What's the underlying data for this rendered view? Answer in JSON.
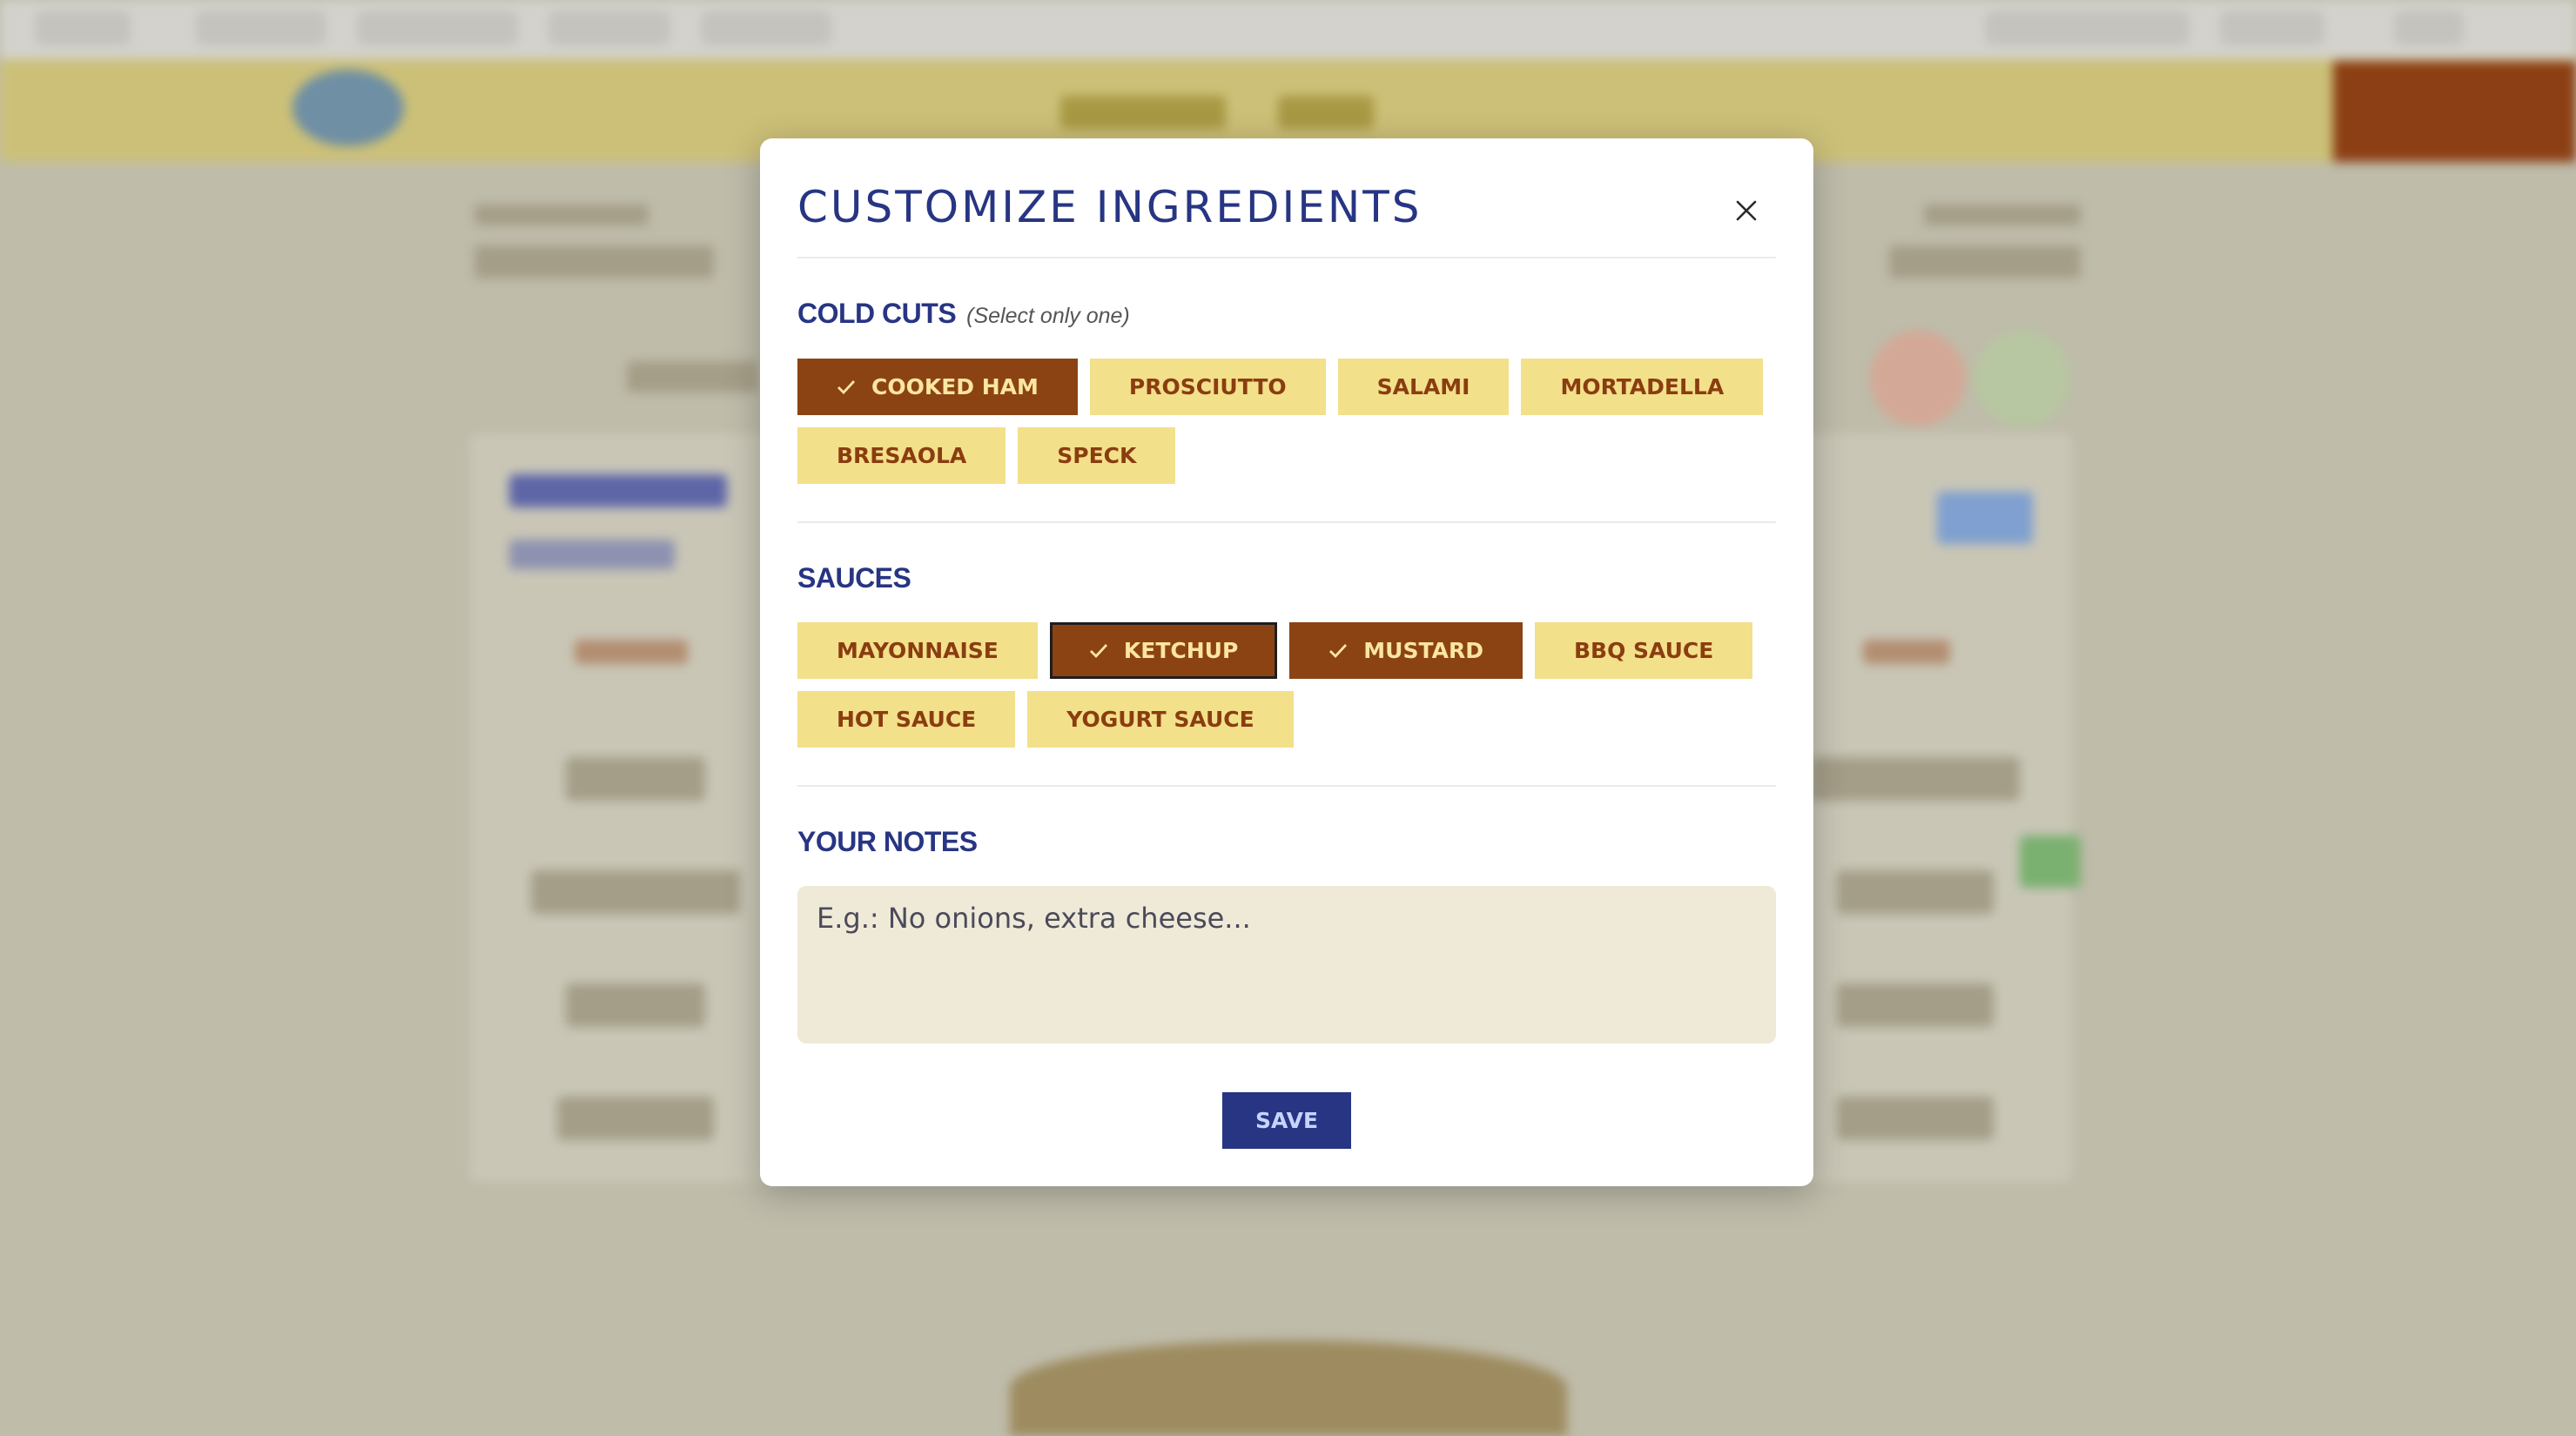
{
  "modal": {
    "title": "CUSTOMIZE INGREDIENTS",
    "close_icon": "close-icon"
  },
  "cold_cuts": {
    "title": "COLD CUTS",
    "hint": "(Select only one)",
    "options": [
      {
        "label": "COOKED HAM",
        "selected": true
      },
      {
        "label": "PROSCIUTTO",
        "selected": false
      },
      {
        "label": "SALAMI",
        "selected": false
      },
      {
        "label": "MORTADELLA",
        "selected": false
      },
      {
        "label": "BRESAOLA",
        "selected": false
      },
      {
        "label": "SPECK",
        "selected": false
      }
    ]
  },
  "sauces": {
    "title": "SAUCES",
    "options": [
      {
        "label": "MAYONNAISE",
        "selected": false
      },
      {
        "label": "KETCHUP",
        "selected": true
      },
      {
        "label": "MUSTARD",
        "selected": true
      },
      {
        "label": "BBQ SAUCE",
        "selected": false
      },
      {
        "label": "HOT SAUCE",
        "selected": false
      },
      {
        "label": "YOGURT SAUCE",
        "selected": false
      }
    ]
  },
  "notes": {
    "title": "YOUR NOTES",
    "placeholder": "E.g.: No onions, extra cheese..."
  },
  "save_label": "SAVE",
  "colors": {
    "brand_blue": "#273583",
    "chip_bg": "#f3e08a",
    "chip_text": "#8a3d10",
    "chip_selected_bg": "#8c4314",
    "notes_bg": "#efe9d7"
  }
}
